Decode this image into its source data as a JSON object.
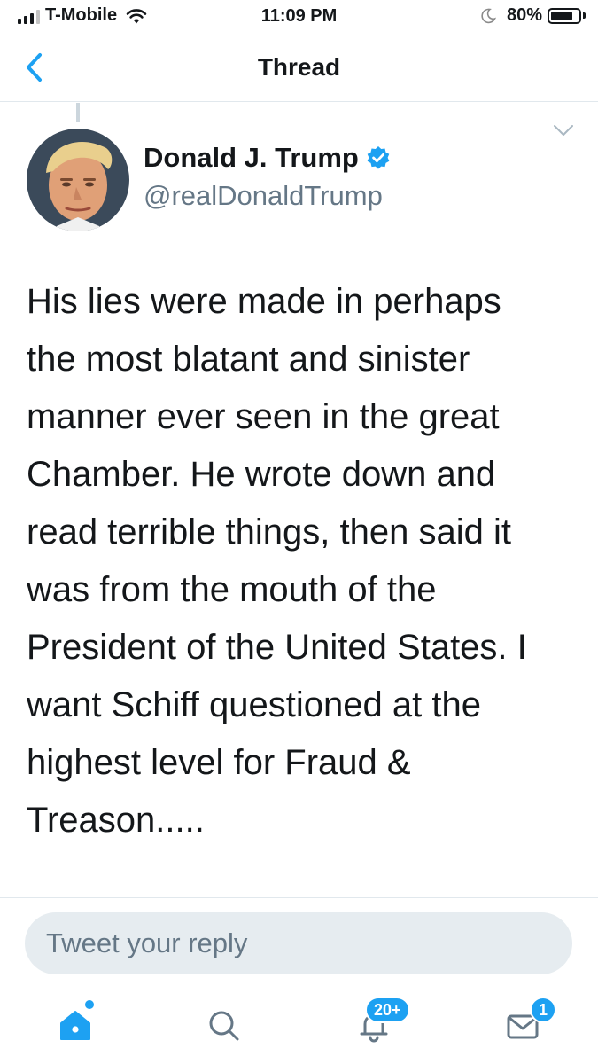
{
  "status_bar": {
    "carrier": "T-Mobile",
    "time": "11:09 PM",
    "battery_percent": "80%",
    "battery_level": 0.8,
    "signal_bars_filled": 3,
    "signal_bars_total": 4,
    "icons": [
      "signal-icon",
      "wifi-icon",
      "moon-icon",
      "battery-icon"
    ]
  },
  "nav": {
    "title": "Thread",
    "back_icon": "chevron-left-icon"
  },
  "tweet": {
    "author_name": "Donald J. Trump",
    "author_handle": "@realDonaldTrump",
    "verified": true,
    "text": "His lies were made in perhaps\nthe most blatant and sinister\nmanner ever seen in the great\nChamber. He wrote down and\nread terrible things, then said it\nwas from the mouth of the\nPresident of the United States. I\nwant Schiff questioned at the\nhighest level for Fraud &\nTreason....."
  },
  "reply": {
    "placeholder": "Tweet your reply"
  },
  "tab_bar": {
    "tabs": [
      {
        "name": "home",
        "icon": "home-icon",
        "active": true
      },
      {
        "name": "search",
        "icon": "search-icon",
        "active": false
      },
      {
        "name": "notifications",
        "icon": "bell-icon",
        "badge": "20+"
      },
      {
        "name": "messages",
        "icon": "envelope-icon",
        "badge": "1"
      }
    ]
  },
  "colors": {
    "accent": "#1da1f2",
    "text_primary": "#14171a",
    "text_secondary": "#657786",
    "input_bg": "#e6ecf0",
    "border": "#e1e8ed"
  }
}
